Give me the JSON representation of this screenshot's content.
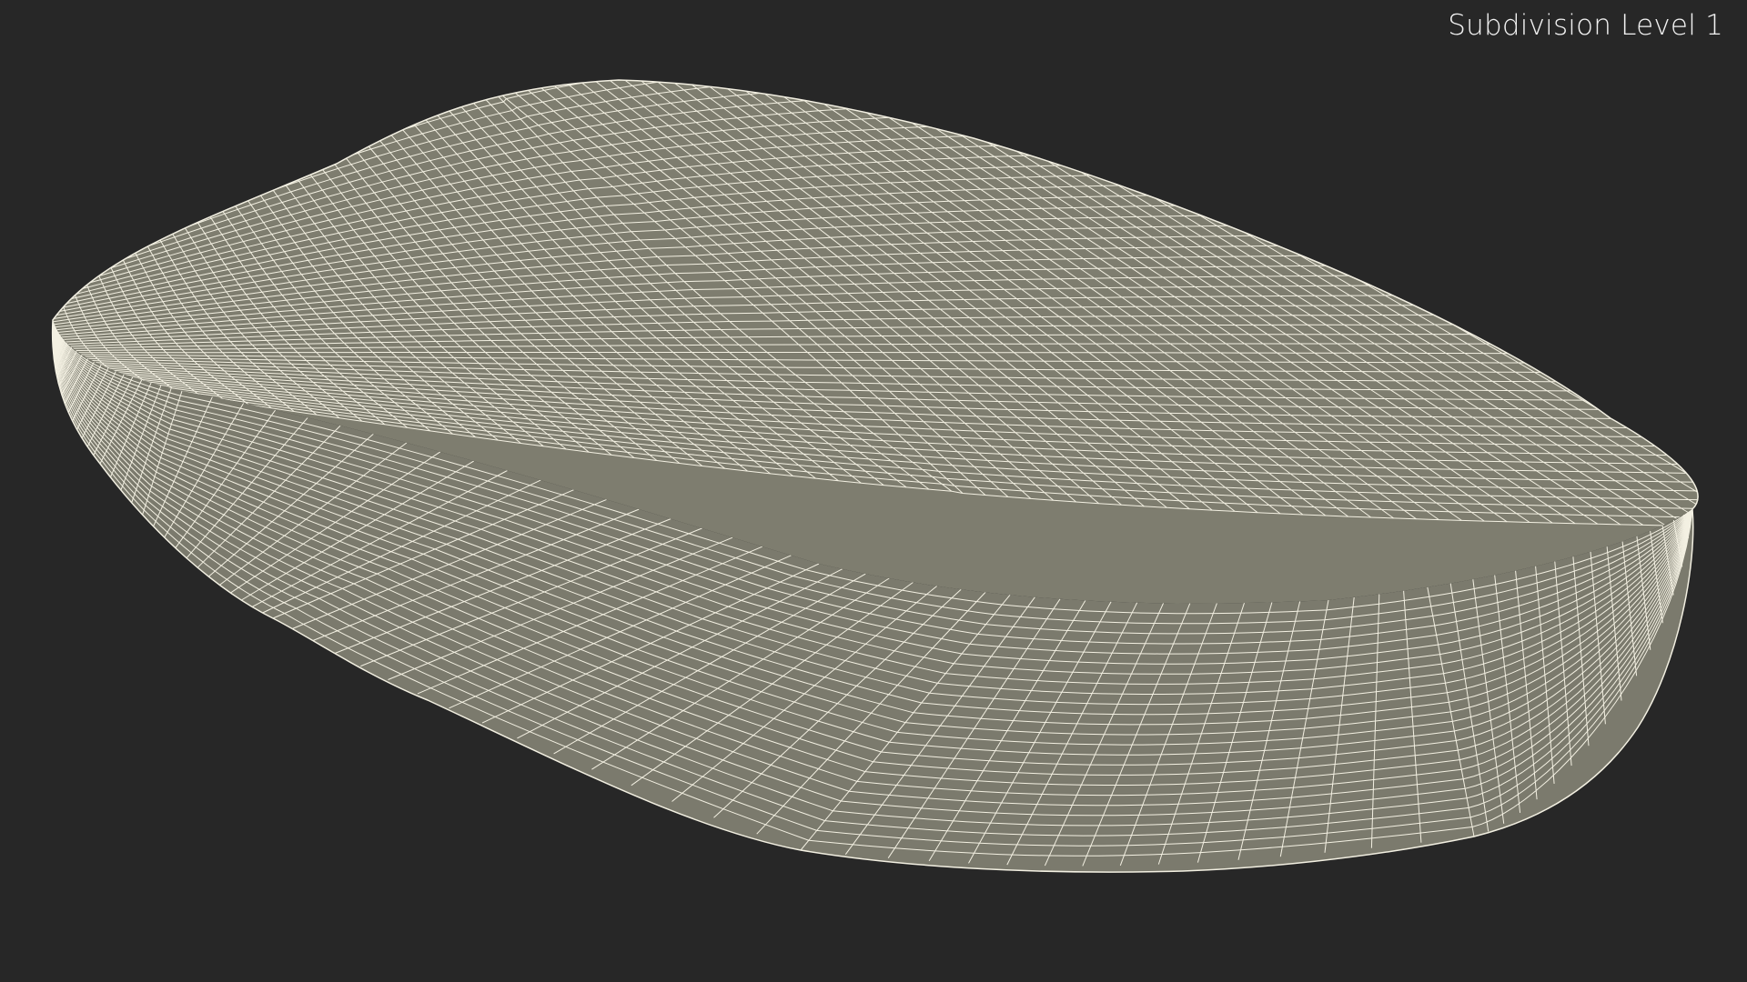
{
  "viewport": {
    "background_color": "#272727",
    "label": "Subdivision Level 1"
  },
  "mesh": {
    "surface_color": "#7e7d6f",
    "wire_color": "#f3f0e2"
  }
}
